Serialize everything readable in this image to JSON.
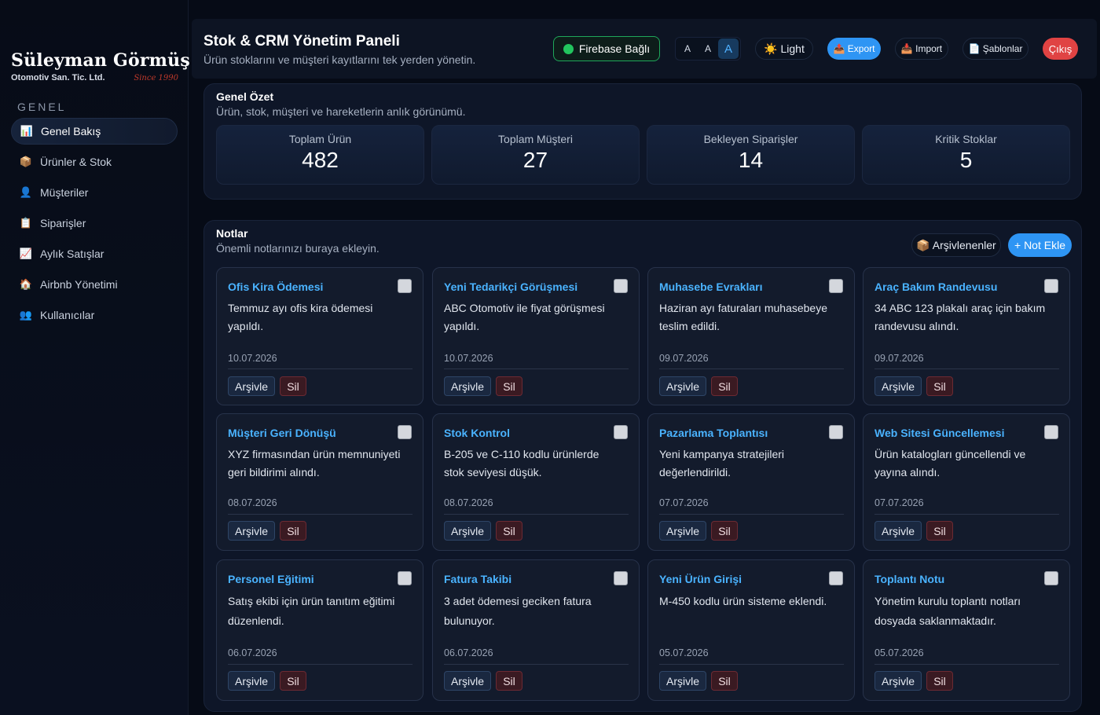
{
  "brand": {
    "name": "Süleyman Görmüş",
    "sub": "Otomotiv San. Tic. Ltd.",
    "since": "Since 1990"
  },
  "sidebar": {
    "section": "GENEL",
    "items": [
      {
        "label": "Genel Bakış",
        "icon": "📊"
      },
      {
        "label": "Ürünler & Stok",
        "icon": "📦"
      },
      {
        "label": "Müşteriler",
        "icon": "👤"
      },
      {
        "label": "Siparişler",
        "icon": "📋"
      },
      {
        "label": "Aylık Satışlar",
        "icon": "📈"
      },
      {
        "label": "Airbnb Yönetimi",
        "icon": "🏠"
      },
      {
        "label": "Kullanıcılar",
        "icon": "👥"
      }
    ]
  },
  "header": {
    "title": "Stok & CRM Yönetim Paneli",
    "subtitle": "Ürün stoklarını ve müşteri kayıtlarını tek yerden yönetin.",
    "firebase": "Firebase Bağlı",
    "font_sizes": [
      "A",
      "A",
      "A"
    ],
    "theme": "☀️ Light",
    "export": "📤 Export",
    "import": "📥 Import",
    "templates": "📄 Şablonlar",
    "logout": "Çıkış"
  },
  "summary": {
    "title": "Genel Özet",
    "subtitle": "Ürün, stok, müşteri ve hareketlerin anlık görünümü.",
    "stats": [
      {
        "label": "Toplam Ürün",
        "value": "482"
      },
      {
        "label": "Toplam Müşteri",
        "value": "27"
      },
      {
        "label": "Bekleyen Siparişler",
        "value": "14"
      },
      {
        "label": "Kritik Stoklar",
        "value": "5"
      }
    ]
  },
  "notes": {
    "title": "Notlar",
    "subtitle": "Önemli notlarınızı buraya ekleyin.",
    "archived_button": "📦 Arşivlenenler",
    "add_button": "+ Not Ekle",
    "archive_label": "Arşivle",
    "delete_label": "Sil",
    "items": [
      {
        "title": "Ofis Kira Ödemesi",
        "body": "Temmuz ayı ofis kira ödemesi yapıldı.",
        "date": "10.07.2026"
      },
      {
        "title": "Yeni Tedarikçi Görüşmesi",
        "body": "ABC Otomotiv ile fiyat görüşmesi yapıldı.",
        "date": "10.07.2026"
      },
      {
        "title": "Muhasebe Evrakları",
        "body": "Haziran ayı faturaları muhasebeye teslim edildi.",
        "date": "09.07.2026"
      },
      {
        "title": "Araç Bakım Randevusu",
        "body": "34 ABC 123 plakalı araç için bakım randevusu alındı.",
        "date": "09.07.2026"
      },
      {
        "title": "Müşteri Geri Dönüşü",
        "body": "XYZ firmasından ürün memnuniyeti geri bildirimi alındı.",
        "date": "08.07.2026"
      },
      {
        "title": "Stok Kontrol",
        "body": "B-205 ve C-110 kodlu ürünlerde stok seviyesi düşük.",
        "date": "08.07.2026"
      },
      {
        "title": "Pazarlama Toplantısı",
        "body": "Yeni kampanya stratejileri değerlendirildi.",
        "date": "07.07.2026"
      },
      {
        "title": "Web Sitesi Güncellemesi",
        "body": "Ürün katalogları güncellendi ve yayına alındı.",
        "date": "07.07.2026"
      },
      {
        "title": "Personel Eğitimi",
        "body": "Satış ekibi için ürün tanıtım eğitimi düzenlendi.",
        "date": "06.07.2026"
      },
      {
        "title": "Fatura Takibi",
        "body": "3 adet ödemesi geciken fatura bulunuyor.",
        "date": "06.07.2026"
      },
      {
        "title": "Yeni Ürün Girişi",
        "body": "M-450 kodlu ürün sisteme eklendi.",
        "date": "05.07.2026"
      },
      {
        "title": "Toplantı Notu",
        "body": "Yönetim kurulu toplantı notları dosyada saklanmaktadır.",
        "date": "05.07.2026"
      }
    ]
  },
  "colors": {
    "accent": "#2e95f4",
    "danger": "#e04343",
    "success": "#22c55e",
    "note_title": "#4ab3ff"
  }
}
